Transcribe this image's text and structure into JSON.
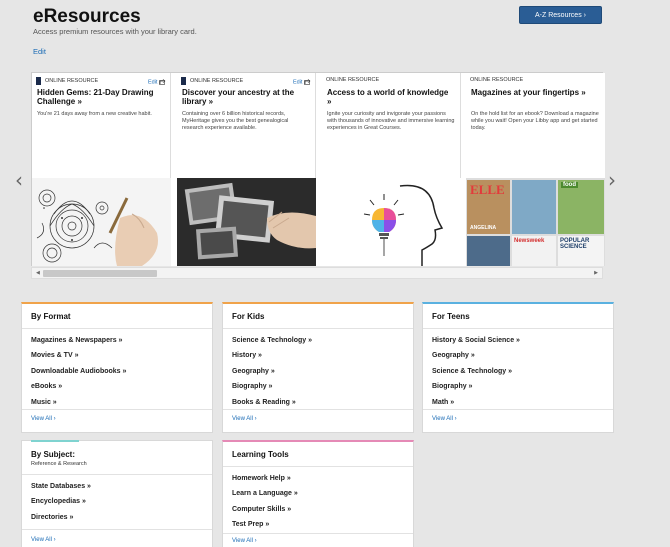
{
  "header": {
    "title": "eResources",
    "subtitle": "Access premium resources with your library card.",
    "edit_label": "Edit",
    "az_button": "A-Z Resources ›"
  },
  "carousel": {
    "prev_icon": "‹",
    "next_icon": "›",
    "cards": [
      {
        "tag": "ONLINE RESOURCE",
        "edit": "Edit",
        "title": "Hidden Gems: 21-Day Drawing Challenge »",
        "desc": "You're 21 days away from a new creative habit.",
        "image": "zentangle-drawing"
      },
      {
        "tag": "ONLINE RESOURCE",
        "edit": "Edit",
        "title": "Discover your ancestry at the library »",
        "desc": "Containing over 6 billion historical records, MyHeritage gives you the best genealogical research experience available.",
        "image": "old-photographs"
      },
      {
        "tag": "ONLINE RESOURCE",
        "edit": "",
        "title": "Access to a world of knowledge »",
        "desc": "Ignite your curiosity and invigorate your passions with thousands of innovative and immersive learning experiences in Great Courses.",
        "image": "lightbulb-head"
      },
      {
        "tag": "ONLINE RESOURCE",
        "edit": "",
        "title": "Magazines at your fingertips »",
        "desc": "On the hold list for an ebook? Download a magazine while you wait! Open your Libby app and get started today.",
        "image": "magazine-covers"
      }
    ],
    "magazine_labels": [
      "ELLE",
      "ANGELINA",
      "Newsweek",
      "POPULAR SCIENCE",
      "food"
    ]
  },
  "boxes": [
    {
      "title": "By Format",
      "accent": "#f0a34a",
      "items": [
        "Magazines & Newspapers »",
        "Movies & TV »",
        "Downloadable Audiobooks »",
        "eBooks »",
        "Music »"
      ],
      "viewall": "View All ›"
    },
    {
      "title": "For Kids",
      "accent": "#f0a34a",
      "items": [
        "Science & Technology »",
        "History »",
        "Geography »",
        "Biography »",
        "Books & Reading »"
      ],
      "viewall": "View All ›"
    },
    {
      "title": "For Teens",
      "accent": "#5ab1e0",
      "items": [
        "History & Social Science »",
        "Geography »",
        "Science & Technology »",
        "Biography »",
        "Math »"
      ],
      "viewall": "View All ›"
    },
    {
      "title": "By Subject:",
      "subtitle": "Reference & Research",
      "accent": "#7fd3d0",
      "items": [
        "State Databases »",
        "Encyclopedias »",
        "Directories »"
      ],
      "viewall": "View All ›"
    },
    {
      "title": "Learning Tools",
      "accent": "#e58ab6",
      "items": [
        "Homework Help »",
        "Learn a Language »",
        "Computer Skills »",
        "Test Prep »"
      ],
      "viewall": "View All ›"
    }
  ]
}
